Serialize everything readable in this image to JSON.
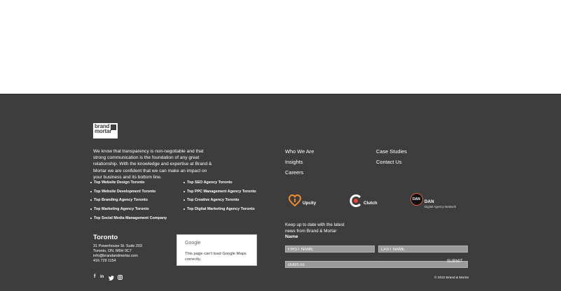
{
  "brand": {
    "line1": "brand",
    "line2": "mortar"
  },
  "about": "We know that transparency is non-negotiable and that strong communication is the foundation of any great relationship. With the knowledge and expertise at Brand & Mortar we are confident that we can make an impact on your business and its bottom line.",
  "services_left": [
    "Top Website Design Toronto",
    "Top Website Development Toronto",
    "Top Branding Agency Toronto",
    "Top Marketing Agency Toronto",
    "Top Social Media Management Company"
  ],
  "services_right": [
    "Top SEO Agency Toronto",
    "Top PPC Management Agency Toronto",
    "Top Creative Agency Toronto",
    "Top Digital Marketing Agency Toronto"
  ],
  "nav_left": [
    "Who We Are",
    "Insights",
    "Careers"
  ],
  "nav_right": [
    "Case Studies",
    "Contact Us"
  ],
  "badges": {
    "upcity": "Upcity",
    "clutch": "Clutch",
    "dan_abbr": "DAN",
    "dan": "DAN",
    "dan_sub": "Digital Agency Network"
  },
  "office": {
    "city": "Toronto",
    "address1": "31 Powerhouse St. Suite 203",
    "address2": "Toronto, ON, M6H 0C7",
    "email": "info@brandandmortar.com",
    "phone": "416 729 1154"
  },
  "map": {
    "brand": "Google",
    "message": "This page can't load Google Maps correctly."
  },
  "newsletter": {
    "text": "Keep up to date with the latest news from Brand & Mortar",
    "name_label": "Name",
    "first_placeholder": "FIRST NAME",
    "last_placeholder": "LAST NAME",
    "email_value": "clutch.co",
    "submit": "SUBMIT"
  },
  "social": {
    "facebook": "f",
    "linkedin": "in",
    "twitter": "t",
    "instagram": "ig"
  },
  "copyright": "© 2022 Brand & Mortar",
  "colors": {
    "footer_bg": "#3d3d3e",
    "upcity_orange": "#f28c28",
    "clutch_red": "#ef4335"
  }
}
